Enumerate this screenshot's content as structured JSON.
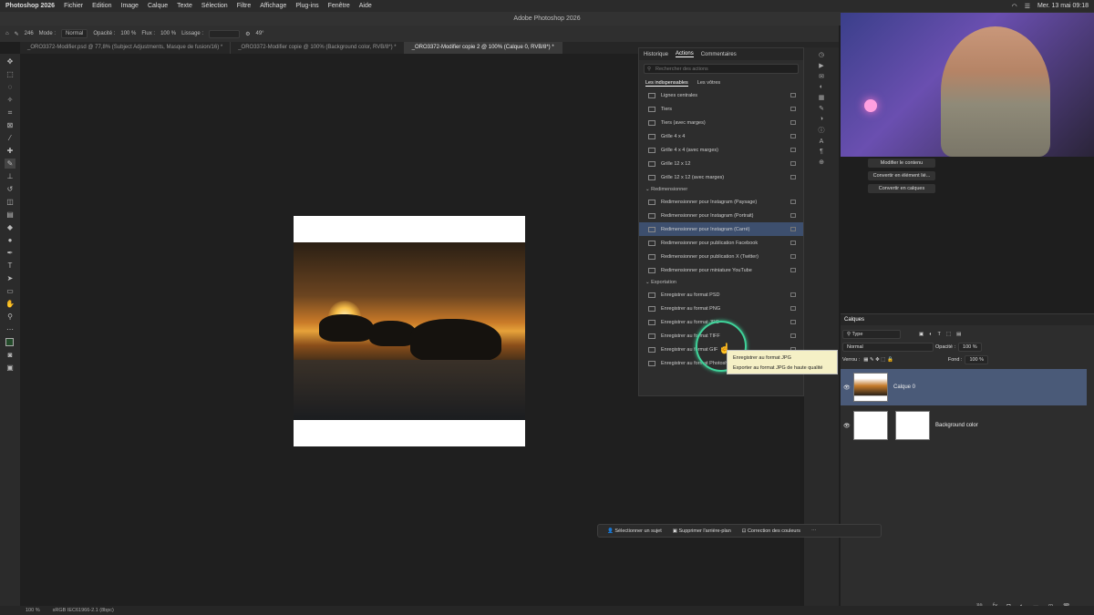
{
  "menubar": {
    "app": "Photoshop 2026",
    "items": [
      "Fichier",
      "Edition",
      "Image",
      "Calque",
      "Texte",
      "Sélection",
      "Filtre",
      "Affichage",
      "Plug-ins",
      "Fenêtre",
      "Aide"
    ],
    "clock": "Mer. 13 mai 09:18"
  },
  "window_title": "Adobe Photoshop 2026",
  "options": {
    "size": "246",
    "mode_label": "Mode :",
    "mode_value": "Normal",
    "opacity_label": "Opacité :",
    "opacity_value": "100 %",
    "flux_label": "Flux :",
    "flux_value": "100 %",
    "lissage_label": "Lissage :",
    "angle": "49°"
  },
  "tabs": [
    "_ORO3372-Modifier.psd @ 77,8% (Subject Adjustments, Masque de fusion/16) *",
    "_ORO3372-Modifier copie @ 100% (Background color, RVB/8*) *",
    "_ORO3372-Modifier copie 2 @ 100% (Calque 0, RVB/8*) *"
  ],
  "actions_panel": {
    "tabs": [
      "Historique",
      "Actions",
      "Commentaires"
    ],
    "search_placeholder": "Rechercher des actions",
    "subtabs": [
      "Les indispensables",
      "Les vôtres"
    ],
    "top_items": [
      "Lignes centrales",
      "Tiers",
      "Tiers (avec marges)",
      "Grille 4 x 4",
      "Grille 4 x 4 (avec marges)",
      "Grille 12 x 12",
      "Grille 12 x 12 (avec marges)"
    ],
    "section_resize": "Redimensionner",
    "resize_items": [
      "Redimensionner pour Instagram (Paysage)",
      "Redimensionner pour Instagram (Portrait)",
      "Redimensionner pour Instagram (Carré)",
      "Redimensionner pour publication Facebook",
      "Redimensionner pour publication X (Twitter)",
      "Redimensionner pour miniature YouTube"
    ],
    "section_export": "Exportation",
    "export_items": [
      "Enregistrer au format PSD",
      "Enregistrer au format PNG",
      "Enregistrer au format JPG",
      "Enregistrer au format TIFF",
      "Enregistrer au format GIF",
      "Enregistrer au format Photoshop PDF"
    ]
  },
  "tooltip": {
    "line1": "Enregistrer au format JPG",
    "line2": "Exporter au format JPG de haute qualité"
  },
  "properties": {
    "buttons": [
      "Modifier le contenu",
      "Convertir en élément lié...",
      "Convertir en calques"
    ]
  },
  "layers": {
    "title": "Calques",
    "filter": "Type",
    "blend": "Normal",
    "opacity_label": "Opacité :",
    "opacity_value": "100 %",
    "lock_label": "Verrou :",
    "fill_label": "Fond :",
    "fill_value": "100 %",
    "items": [
      {
        "name": "Calque 0"
      },
      {
        "name": "Background color"
      }
    ]
  },
  "contextbar": {
    "btn1": "Sélectionner un sujet",
    "btn2": "Supprimer l'arrière-plan",
    "btn3": "Correction des couleurs"
  },
  "statusbar": {
    "zoom": "100 %",
    "profile": "sRGB IEC61966-2.1 (8bpc)"
  }
}
